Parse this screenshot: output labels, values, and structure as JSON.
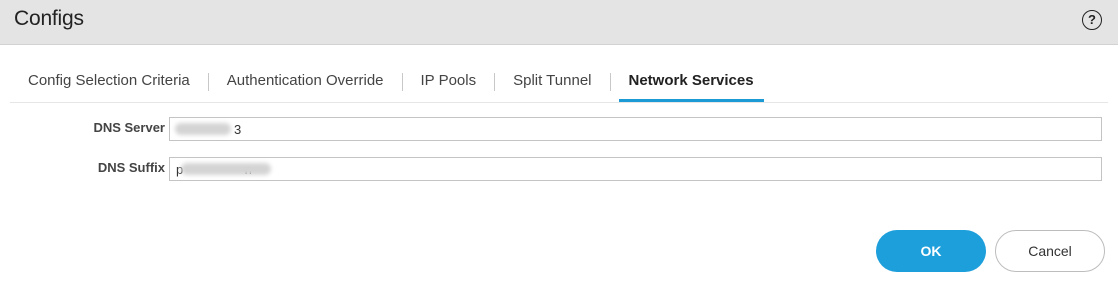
{
  "dialog": {
    "title": "Configs",
    "help_icon": "question-circle-icon",
    "help_glyph": "?"
  },
  "tabs": [
    {
      "label": "Config Selection Criteria",
      "active": false
    },
    {
      "label": "Authentication Override",
      "active": false
    },
    {
      "label": "IP Pools",
      "active": false
    },
    {
      "label": "Split Tunnel",
      "active": false
    },
    {
      "label": "Network Services",
      "active": true
    }
  ],
  "form": {
    "dns_server": {
      "label": "DNS Server",
      "value": "3"
    },
    "dns_suffix": {
      "label": "DNS Suffix",
      "value": "p                 n"
    }
  },
  "buttons": {
    "ok_label": "OK",
    "cancel_label": "Cancel"
  },
  "colors": {
    "accent": "#1d9fdc",
    "header_bg": "#e4e4e4"
  }
}
